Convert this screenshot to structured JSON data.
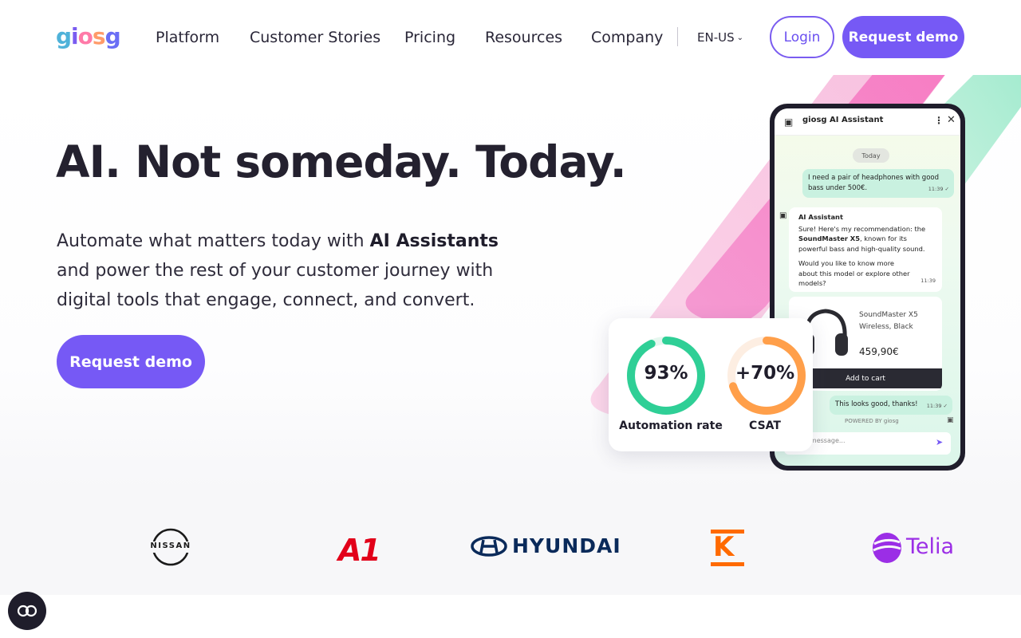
{
  "nav": {
    "logo_letters": [
      "g",
      "i",
      "o",
      "s",
      "g"
    ],
    "links": [
      "Platform",
      "Customer Stories",
      "Pricing",
      "Resources",
      "Company"
    ],
    "language": "EN-US",
    "login": "Login",
    "request_demo": "Request demo"
  },
  "hero": {
    "headline": "AI. Not someday. Today.",
    "sub_before": "Automate what matters today with ",
    "sub_bold": "AI Assistants",
    "sub_after": " and power the rest of your customer journey with digital tools that engage, connect, and convert.",
    "cta": "Request demo"
  },
  "chat": {
    "title": "giosg AI Assistant",
    "day": "Today",
    "user_msg_1": "I need a pair of headphones with good bass under 500€.",
    "user_msg_1_time": "11:39 ✓",
    "ai_label": "AI Assistant",
    "ai_msg_1": "Sure! Here's my recommendation: the",
    "ai_msg_product": "SoundMaster X5",
    "ai_msg_2": ", known for its powerful bass and high-quality sound.",
    "ai_msg_3": "Would you like to know more about this model or explore other models?",
    "ai_time": "11:39",
    "product_name": "SoundMaster X5 Wireless, Black",
    "product_price": "459,90€",
    "add_to_cart": "Add to cart",
    "user_msg_2": "This looks good, thanks!",
    "user_msg_2_time": "11:39 ✓",
    "powered_by": "POWERED BY giosg",
    "input_placeholder": "Type message..."
  },
  "stats": [
    {
      "value": "93%",
      "label": "Automation rate",
      "fraction": 0.93,
      "color": "#2fcf96"
    },
    {
      "value": "+70%",
      "label": "CSAT",
      "fraction": 0.7,
      "color": "#ff9f4a"
    }
  ],
  "brands": [
    "NISSAN",
    "A1",
    "HYUNDAI",
    "K",
    "Telia"
  ],
  "colors": {
    "primary": "#7659f5",
    "pink": "#ff7ab8",
    "mint": "#7de3bf"
  },
  "icons": {
    "consent": "cookie-consent-icon",
    "language_chevron": "chevron-down-icon"
  }
}
